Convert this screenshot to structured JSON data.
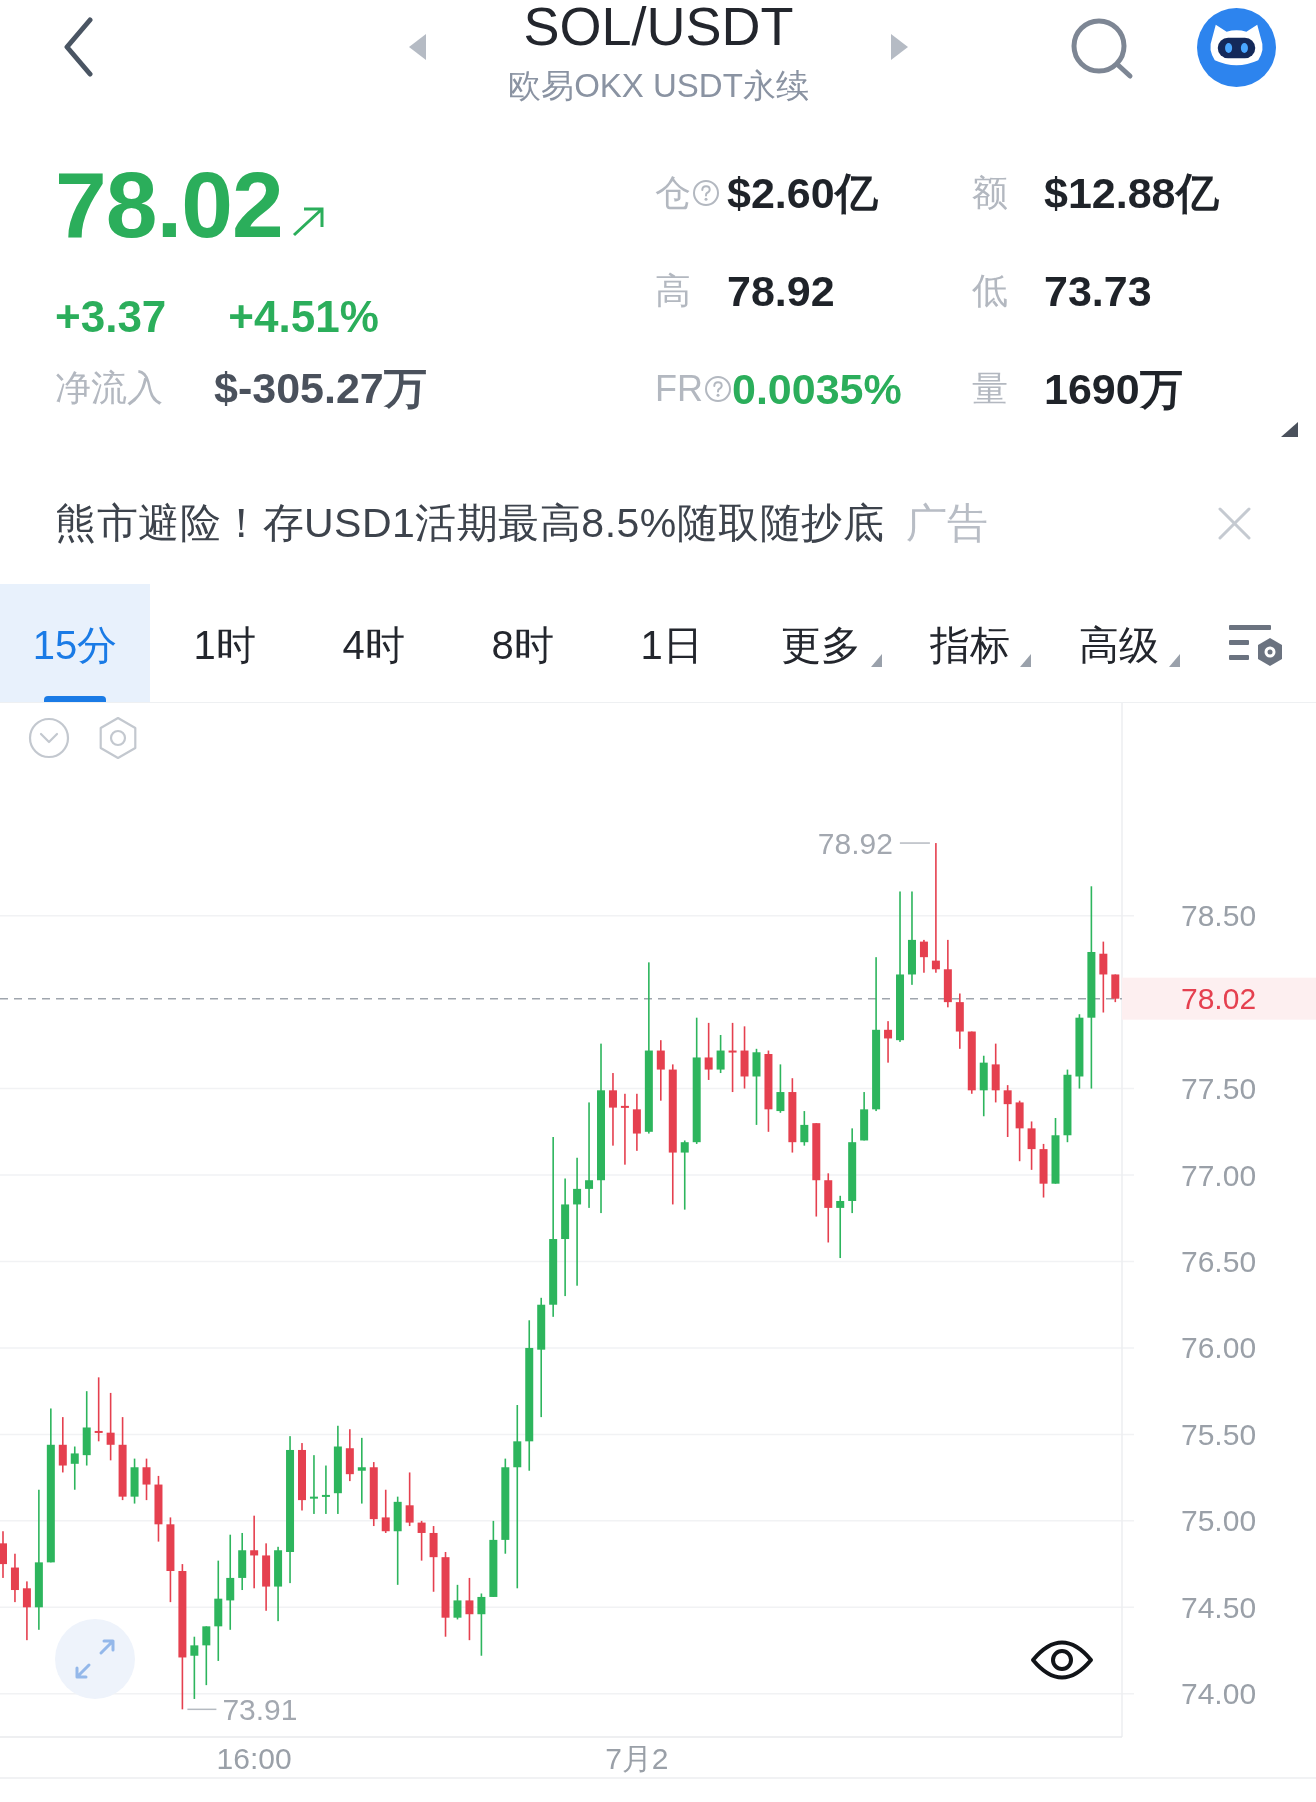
{
  "header": {
    "title": "SOL/USDT",
    "subtitle": "欧易OKX USDT永续"
  },
  "ticker": {
    "price": "78.02",
    "rising": true,
    "change": "+3.37",
    "change_percent": "+4.51%",
    "net_inflow": {
      "label": "净流入",
      "value": "$-305.27万"
    }
  },
  "stats": [
    {
      "label": "仓",
      "has_help": true,
      "value": "$2.60亿",
      "positive": false
    },
    {
      "label": "额",
      "has_help": false,
      "value": "$12.88亿",
      "positive": false
    },
    {
      "label": "高",
      "has_help": false,
      "value": "78.92",
      "positive": false
    },
    {
      "label": "低",
      "has_help": false,
      "value": "73.73",
      "positive": false
    },
    {
      "label": "FR",
      "has_help": true,
      "value": "0.0035%",
      "positive": true
    },
    {
      "label": "量",
      "has_help": false,
      "value": "1690万",
      "positive": false
    }
  ],
  "ad": {
    "text": "熊市避险！存USD1活期最高8.5%随取随抄底",
    "tag": "广告"
  },
  "tabs": [
    {
      "label": "15分",
      "kind": "interval",
      "selected": true
    },
    {
      "label": "1时",
      "kind": "interval",
      "selected": false
    },
    {
      "label": "4时",
      "kind": "interval",
      "selected": false
    },
    {
      "label": "8时",
      "kind": "interval",
      "selected": false
    },
    {
      "label": "1日",
      "kind": "interval",
      "selected": false
    },
    {
      "label": "更多",
      "kind": "menu",
      "selected": false
    },
    {
      "label": "指标",
      "kind": "menu",
      "selected": false
    },
    {
      "label": "高级",
      "kind": "menu",
      "selected": false
    }
  ],
  "chart": {
    "chart_data": {
      "type": "candlestick",
      "grid": true,
      "categories": [
        null,
        null,
        null,
        null,
        null,
        null,
        null,
        null,
        null,
        null,
        null,
        null,
        null,
        null,
        null,
        null,
        null,
        null,
        null,
        null,
        null,
        "16:00",
        null,
        null,
        null,
        null,
        null,
        null,
        null,
        null,
        null,
        null,
        null,
        null,
        null,
        null,
        null,
        null,
        null,
        null,
        null,
        null,
        null,
        null,
        null,
        null,
        null,
        null,
        null,
        null,
        null,
        null,
        null,
        "7月2",
        null,
        null,
        null,
        null,
        null,
        null,
        null,
        null,
        null,
        null,
        null,
        null,
        null,
        null,
        null,
        null,
        null,
        null,
        null,
        null,
        null,
        null,
        null,
        null,
        null,
        null,
        null,
        null,
        null,
        null,
        null,
        null,
        null,
        null,
        null,
        null,
        null,
        null,
        null,
        null
      ],
      "ohlc": [
        [
          74.87,
          74.94,
          74.67,
          74.75
        ],
        [
          74.73,
          74.81,
          74.53,
          74.6
        ],
        [
          74.61,
          74.65,
          74.31,
          74.5
        ],
        [
          74.5,
          75.18,
          74.37,
          74.76
        ],
        [
          74.76,
          75.65,
          74.76,
          75.44
        ],
        [
          75.44,
          75.6,
          75.28,
          75.32
        ],
        [
          75.33,
          75.43,
          75.18,
          75.39
        ],
        [
          75.38,
          75.75,
          75.32,
          75.54
        ],
        [
          75.52,
          75.83,
          75.46,
          75.51
        ],
        [
          75.51,
          75.74,
          75.35,
          75.44
        ],
        [
          75.44,
          75.6,
          75.12,
          75.14
        ],
        [
          75.14,
          75.36,
          75.1,
          75.31
        ],
        [
          75.31,
          75.36,
          75.12,
          75.21
        ],
        [
          75.21,
          75.26,
          74.88,
          74.98
        ],
        [
          74.98,
          75.02,
          74.53,
          74.71
        ],
        [
          74.71,
          74.75,
          73.91,
          74.21
        ],
        [
          74.22,
          74.33,
          73.97,
          74.28
        ],
        [
          74.28,
          74.39,
          74.05,
          74.39
        ],
        [
          74.39,
          74.77,
          74.19,
          74.55
        ],
        [
          74.54,
          74.92,
          74.37,
          74.67
        ],
        [
          74.67,
          74.93,
          74.6,
          74.83
        ],
        [
          74.83,
          75.03,
          74.61,
          74.8
        ],
        [
          74.8,
          74.87,
          74.48,
          74.62
        ],
        [
          74.62,
          74.85,
          74.42,
          74.83
        ],
        [
          74.82,
          75.49,
          74.64,
          75.41
        ],
        [
          75.41,
          75.45,
          75.06,
          75.12
        ],
        [
          75.13,
          75.38,
          75.04,
          75.14
        ],
        [
          75.14,
          75.32,
          75.04,
          75.15
        ],
        [
          75.16,
          75.55,
          75.04,
          75.43
        ],
        [
          75.42,
          75.53,
          75.23,
          75.27
        ],
        [
          75.29,
          75.48,
          75.1,
          75.31
        ],
        [
          75.31,
          75.34,
          74.97,
          75.01
        ],
        [
          75.02,
          75.18,
          74.93,
          74.94
        ],
        [
          74.94,
          75.14,
          74.63,
          75.11
        ],
        [
          75.09,
          75.28,
          74.97,
          74.99
        ],
        [
          74.99,
          75.0,
          74.77,
          74.93
        ],
        [
          74.93,
          74.97,
          74.59,
          74.79
        ],
        [
          74.79,
          74.82,
          74.33,
          74.44
        ],
        [
          74.44,
          74.63,
          74.43,
          74.54
        ],
        [
          74.54,
          74.67,
          74.31,
          74.46
        ],
        [
          74.46,
          74.58,
          74.22,
          74.56
        ],
        [
          74.56,
          75.0,
          74.56,
          74.89
        ],
        [
          74.89,
          75.36,
          74.81,
          75.31
        ],
        [
          75.31,
          75.67,
          74.61,
          75.46
        ],
        [
          75.46,
          76.16,
          75.29,
          76.0
        ],
        [
          75.99,
          76.29,
          75.6,
          76.25
        ],
        [
          76.25,
          77.22,
          76.18,
          76.63
        ],
        [
          76.63,
          76.98,
          76.3,
          76.83
        ],
        [
          76.83,
          77.1,
          76.36,
          76.92
        ],
        [
          76.92,
          77.42,
          76.81,
          76.97
        ],
        [
          76.97,
          77.76,
          76.78,
          77.49
        ],
        [
          77.49,
          77.59,
          77.17,
          77.39
        ],
        [
          77.4,
          77.47,
          77.06,
          77.39
        ],
        [
          77.38,
          77.47,
          77.14,
          77.24
        ],
        [
          77.25,
          78.23,
          77.24,
          77.72
        ],
        [
          77.72,
          77.78,
          77.43,
          77.61
        ],
        [
          77.61,
          77.64,
          76.83,
          77.13
        ],
        [
          77.13,
          77.2,
          76.8,
          77.19
        ],
        [
          77.19,
          77.91,
          77.18,
          77.68
        ],
        [
          77.68,
          77.88,
          77.55,
          77.61
        ],
        [
          77.61,
          77.81,
          77.59,
          77.72
        ],
        [
          77.72,
          77.88,
          77.48,
          77.71
        ],
        [
          77.72,
          77.86,
          77.5,
          77.57
        ],
        [
          77.57,
          77.73,
          77.29,
          77.71
        ],
        [
          77.7,
          77.72,
          77.25,
          77.38
        ],
        [
          77.37,
          77.64,
          77.36,
          77.48
        ],
        [
          77.48,
          77.56,
          77.13,
          77.19
        ],
        [
          77.19,
          77.37,
          77.17,
          77.29
        ],
        [
          77.3,
          77.3,
          76.76,
          76.97
        ],
        [
          76.97,
          77.01,
          76.61,
          76.81
        ],
        [
          76.81,
          76.88,
          76.52,
          76.85
        ],
        [
          76.85,
          77.27,
          76.78,
          77.19
        ],
        [
          77.2,
          77.48,
          77.2,
          77.38
        ],
        [
          77.38,
          78.26,
          77.37,
          77.84
        ],
        [
          77.84,
          77.89,
          77.65,
          77.79
        ],
        [
          77.78,
          78.64,
          77.77,
          78.16
        ],
        [
          78.16,
          78.64,
          78.1,
          78.36
        ],
        [
          78.35,
          78.36,
          78.17,
          78.26
        ],
        [
          78.24,
          78.92,
          78.17,
          78.19
        ],
        [
          78.19,
          78.36,
          77.97,
          78.0
        ],
        [
          78.0,
          78.05,
          77.73,
          77.83
        ],
        [
          77.83,
          77.83,
          77.47,
          77.49
        ],
        [
          77.49,
          77.69,
          77.34,
          77.65
        ],
        [
          77.64,
          77.76,
          77.42,
          77.49
        ],
        [
          77.49,
          77.52,
          77.22,
          77.41
        ],
        [
          77.42,
          77.43,
          77.08,
          77.27
        ],
        [
          77.27,
          77.31,
          77.03,
          77.15
        ],
        [
          77.15,
          77.18,
          76.87,
          76.95
        ],
        [
          76.95,
          77.33,
          76.95,
          77.23
        ],
        [
          77.23,
          77.61,
          77.19,
          77.58
        ],
        [
          77.57,
          77.93,
          77.5,
          77.91
        ],
        [
          77.91,
          78.67,
          77.5,
          78.29
        ],
        [
          78.28,
          78.35,
          77.94,
          78.16
        ],
        [
          78.16,
          78.16,
          78.0,
          78.02
        ]
      ],
      "ylim": [
        73.75,
        79.73
      ],
      "yticks": [
        {
          "value": 78.5,
          "label": "78.50"
        },
        {
          "value": 77.5,
          "label": "77.50"
        },
        {
          "value": 77,
          "label": "77.00"
        },
        {
          "value": 76.5,
          "label": "76.50"
        },
        {
          "value": 76,
          "label": "76.00"
        },
        {
          "value": 75.5,
          "label": "75.50"
        },
        {
          "value": 75,
          "label": "75.00"
        },
        {
          "value": 74.5,
          "label": "74.50"
        },
        {
          "value": 74,
          "label": "74.00"
        }
      ],
      "ref_lines": [
        {
          "axis": "y",
          "value": 78.02,
          "label": "78.02"
        }
      ],
      "annotations": [
        "78.92",
        "73.91"
      ]
    }
  }
}
